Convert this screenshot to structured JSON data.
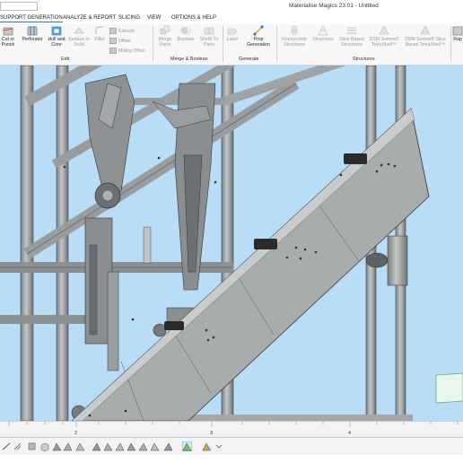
{
  "window": {
    "title": "Materialise Magics 23.01 - Untitled"
  },
  "menu": {
    "items": [
      {
        "label": "SUPPORT GENERATION",
        "active": true
      },
      {
        "label": "ANALYZE & REPORT"
      },
      {
        "label": "SLICING"
      },
      {
        "label": "VIEW"
      },
      {
        "label": "OPTIONS & HELP"
      }
    ]
  },
  "ribbon": {
    "buttons": [
      {
        "label": "Cut or\nPunch",
        "icon": "cut-punch-icon",
        "enabled": true
      },
      {
        "label": "Perforator",
        "icon": "perforator-icon",
        "enabled": true
      },
      {
        "label": "Hull and\nCore",
        "icon": "hull-core-icon",
        "enabled": true
      },
      {
        "label": "Surface to\nSolid",
        "icon": "surface-solid-icon",
        "enabled": false
      },
      {
        "label": "Fillet",
        "icon": "fillet-icon",
        "enabled": false
      },
      {
        "label": "Merge\nParts",
        "icon": "merge-parts-icon",
        "enabled": false
      },
      {
        "label": "Boolean",
        "icon": "boolean-icon",
        "enabled": false
      },
      {
        "label": "Shells To\nParts",
        "icon": "shells-parts-icon",
        "enabled": false
      },
      {
        "label": "Label\n-",
        "icon": "label-icon",
        "enabled": false
      },
      {
        "label": "Prop\nGeneration",
        "icon": "prop-generation-icon",
        "enabled": true
      },
      {
        "label": "Honeycomb\nStructures",
        "icon": "honeycomb-icon",
        "enabled": false
      },
      {
        "label": "Structures",
        "icon": "structures-icon",
        "enabled": false
      },
      {
        "label": "Slice Based\nStructures",
        "icon": "slice-structures-icon",
        "enabled": false
      },
      {
        "label": "DSM Somos®\nTetraShell™",
        "icon": "tetrashell-icon",
        "enabled": false
      },
      {
        "label": "DSM Somos® Slice\nBased TetraShell™",
        "icon": "slice-tetrashell-icon",
        "enabled": false
      },
      {
        "label": "Rap",
        "icon": "rapid-icon",
        "enabled": true
      }
    ],
    "small_buttons": [
      "Extrude",
      "Offset",
      "Milling Offset"
    ],
    "groups": [
      "Edit",
      "Merge & Boolean",
      "Generate",
      "Structures"
    ]
  },
  "ruler": {
    "labels": [
      "2",
      "3",
      "4"
    ]
  },
  "colors": {
    "viewport": "#b9dcf7",
    "model": "#a9acad",
    "accent": "#2b78c5"
  }
}
